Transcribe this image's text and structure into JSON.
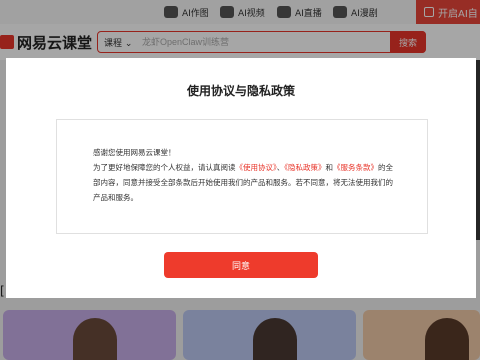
{
  "top_bar": {
    "links": [
      {
        "label": "AI作图",
        "icon": "image-icon"
      },
      {
        "label": "AI视频",
        "icon": "video-icon"
      },
      {
        "label": "AI直播",
        "icon": "live-icon"
      },
      {
        "label": "AI漫剧",
        "icon": "comic-icon"
      }
    ],
    "open_ai_label": "开启AI自"
  },
  "header": {
    "logo_text": "网易云课堂",
    "search": {
      "category": "课程",
      "placeholder": "龙虾OpenClaw训练营",
      "button": "搜索"
    }
  },
  "dialog": {
    "title": "使用协议与隐私政策",
    "greeting": "感谢您使用网易云课堂！",
    "body_part1": "为了更好地保障您的个人权益，请认真阅读",
    "link_terms": "《使用协议》",
    "sep1": "、",
    "link_privacy": "《隐私政策》",
    "sep2": "和",
    "link_service": "《服务条款》",
    "body_part2": "的全部内容，同意并接受全部条款后开始使用我们的产品和服务。若不同意，将无法使用我们的产品和服务。",
    "agree_button": "同意"
  },
  "colors": {
    "brand_red": "#e8352a",
    "button_red": "#ee3b2c"
  }
}
